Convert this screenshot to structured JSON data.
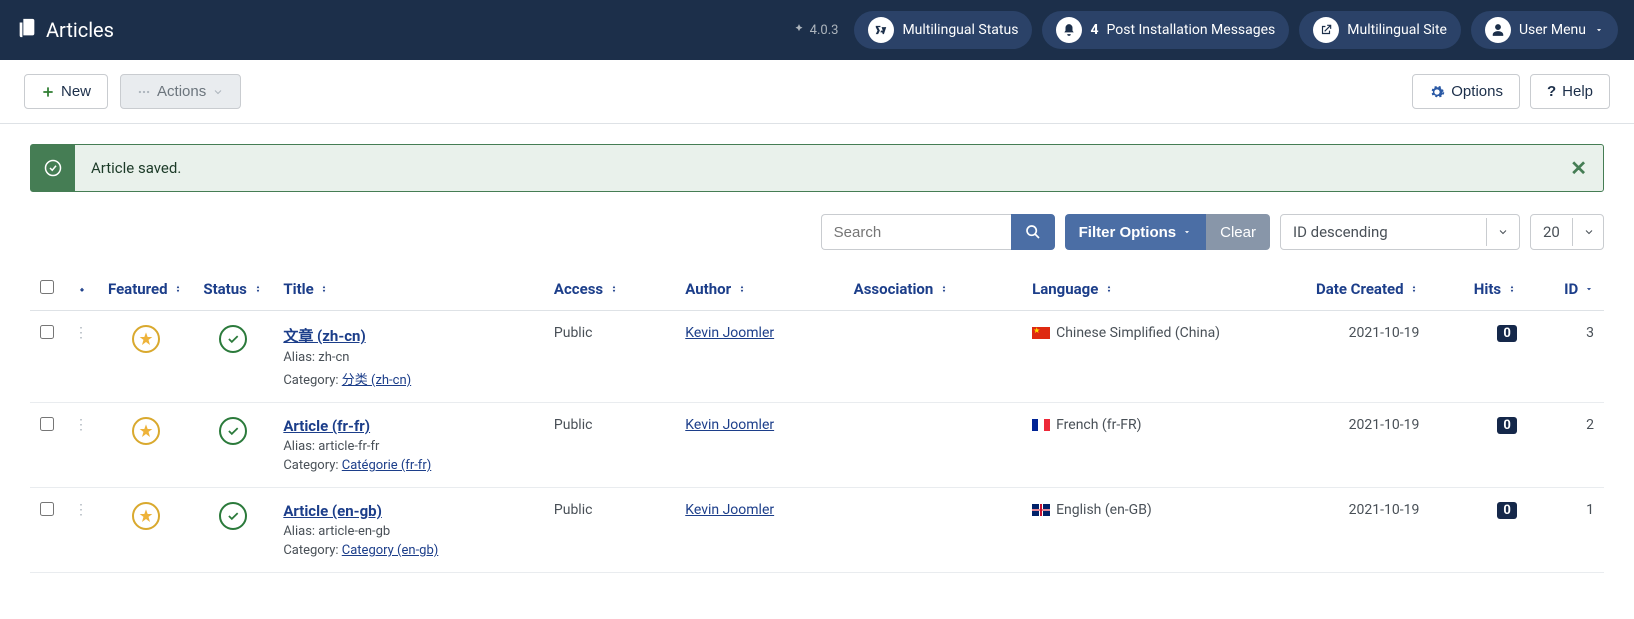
{
  "header": {
    "title": "Articles",
    "version": "4.0.3",
    "multilingual_status": "Multilingual Status",
    "notif_count": "4",
    "post_install": "Post Installation Messages",
    "multilingual_site": "Multilingual Site",
    "user_menu": "User Menu"
  },
  "toolbar": {
    "new": "New",
    "actions": "Actions",
    "options": "Options",
    "help": "Help"
  },
  "alert": {
    "message": "Article saved."
  },
  "filters": {
    "search_placeholder": "Search",
    "filter_options": "Filter Options",
    "clear": "Clear",
    "sort": "ID descending",
    "limit": "20"
  },
  "labels": {
    "alias": "Alias:",
    "category": "Category:"
  },
  "columns": {
    "featured": "Featured",
    "status": "Status",
    "title": "Title",
    "access": "Access",
    "author": "Author",
    "association": "Association",
    "language": "Language",
    "date_created": "Date Created",
    "hits": "Hits",
    "id": "ID"
  },
  "rows": [
    {
      "title": "文章 (zh-cn)",
      "alias": "zh-cn",
      "category": "分类 (zh-cn)",
      "access": "Public",
      "author": "Kevin Joomler",
      "language": "Chinese Simplified (China)",
      "flag": "cn",
      "date": "2021-10-19",
      "hits": "0",
      "id": "3"
    },
    {
      "title": "Article (fr-fr)",
      "alias": "article-fr-fr",
      "category": "Catégorie (fr-fr)",
      "access": "Public",
      "author": "Kevin Joomler",
      "language": "French (fr-FR)",
      "flag": "fr",
      "date": "2021-10-19",
      "hits": "0",
      "id": "2"
    },
    {
      "title": "Article (en-gb)",
      "alias": "article-en-gb",
      "category": "Category (en-gb)",
      "access": "Public",
      "author": "Kevin Joomler",
      "language": "English (en-GB)",
      "flag": "gb",
      "date": "2021-10-19",
      "hits": "0",
      "id": "1"
    }
  ]
}
